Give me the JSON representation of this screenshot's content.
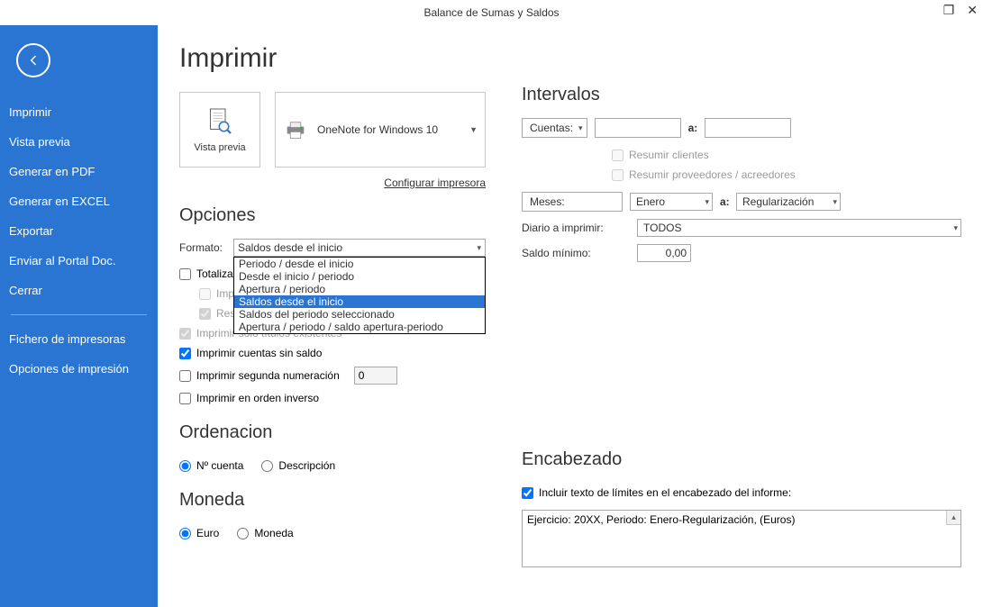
{
  "window": {
    "title": "Balance de Sumas y Saldos"
  },
  "sidebar": {
    "items": [
      "Imprimir",
      "Vista previa",
      "Generar en PDF",
      "Generar en EXCEL",
      "Exportar",
      "Enviar al Portal Doc.",
      "Cerrar"
    ],
    "extra": [
      "Fichero de impresoras",
      "Opciones de impresión"
    ]
  },
  "page_title": "Imprimir",
  "preview": {
    "label": "Vista previa",
    "printer": "OneNote for Windows 10",
    "config_link": "Configurar impresora"
  },
  "opciones": {
    "heading": "Opciones",
    "formato_label": "Formato:",
    "formato_value": "Saldos desde el inicio",
    "formato_options": [
      "Periodo / desde el inicio",
      "Desde el inicio / periodo",
      "Apertura / periodo",
      "Saldos desde el inicio",
      "Saldos del periodo seleccionado",
      "Apertura / periodo / saldo apertura-periodo"
    ],
    "formato_selected_index": 3,
    "chk_totalizar": "Totalizar",
    "chk_imp": "Imp",
    "chk_res": "Res",
    "chk_titulos": "Imprimir solo títulos existentes",
    "chk_sin_saldo": "Imprimir cuentas sin saldo",
    "chk_segunda_num": "Imprimir segunda numeración",
    "segunda_num_value": "0",
    "chk_inverso": "Imprimir en orden inverso"
  },
  "ordenacion": {
    "heading": "Ordenacion",
    "opt_numero": "Nº cuenta",
    "opt_desc": "Descripción"
  },
  "moneda": {
    "heading": "Moneda",
    "opt_euro": "Euro",
    "opt_moneda": "Moneda"
  },
  "intervalos": {
    "heading": "Intervalos",
    "cuentas_btn": "Cuentas:",
    "a_label": "a:",
    "chk_resumir_cli": "Resumir clientes",
    "chk_resumir_prov": "Resumir proveedores / acreedores",
    "meses_btn": "Meses:",
    "mes_from": "Enero",
    "mes_to": "Regularización",
    "diario_label": "Diario a imprimir:",
    "diario_value": "TODOS",
    "saldo_min_label": "Saldo mínimo:",
    "saldo_min_value": "0,00"
  },
  "encabezado": {
    "heading": "Encabezado",
    "chk_incluir": "Incluir texto de límites en el encabezado del informe:",
    "text": "Ejercicio: 20XX, Periodo: Enero-Regularización, (Euros)"
  }
}
